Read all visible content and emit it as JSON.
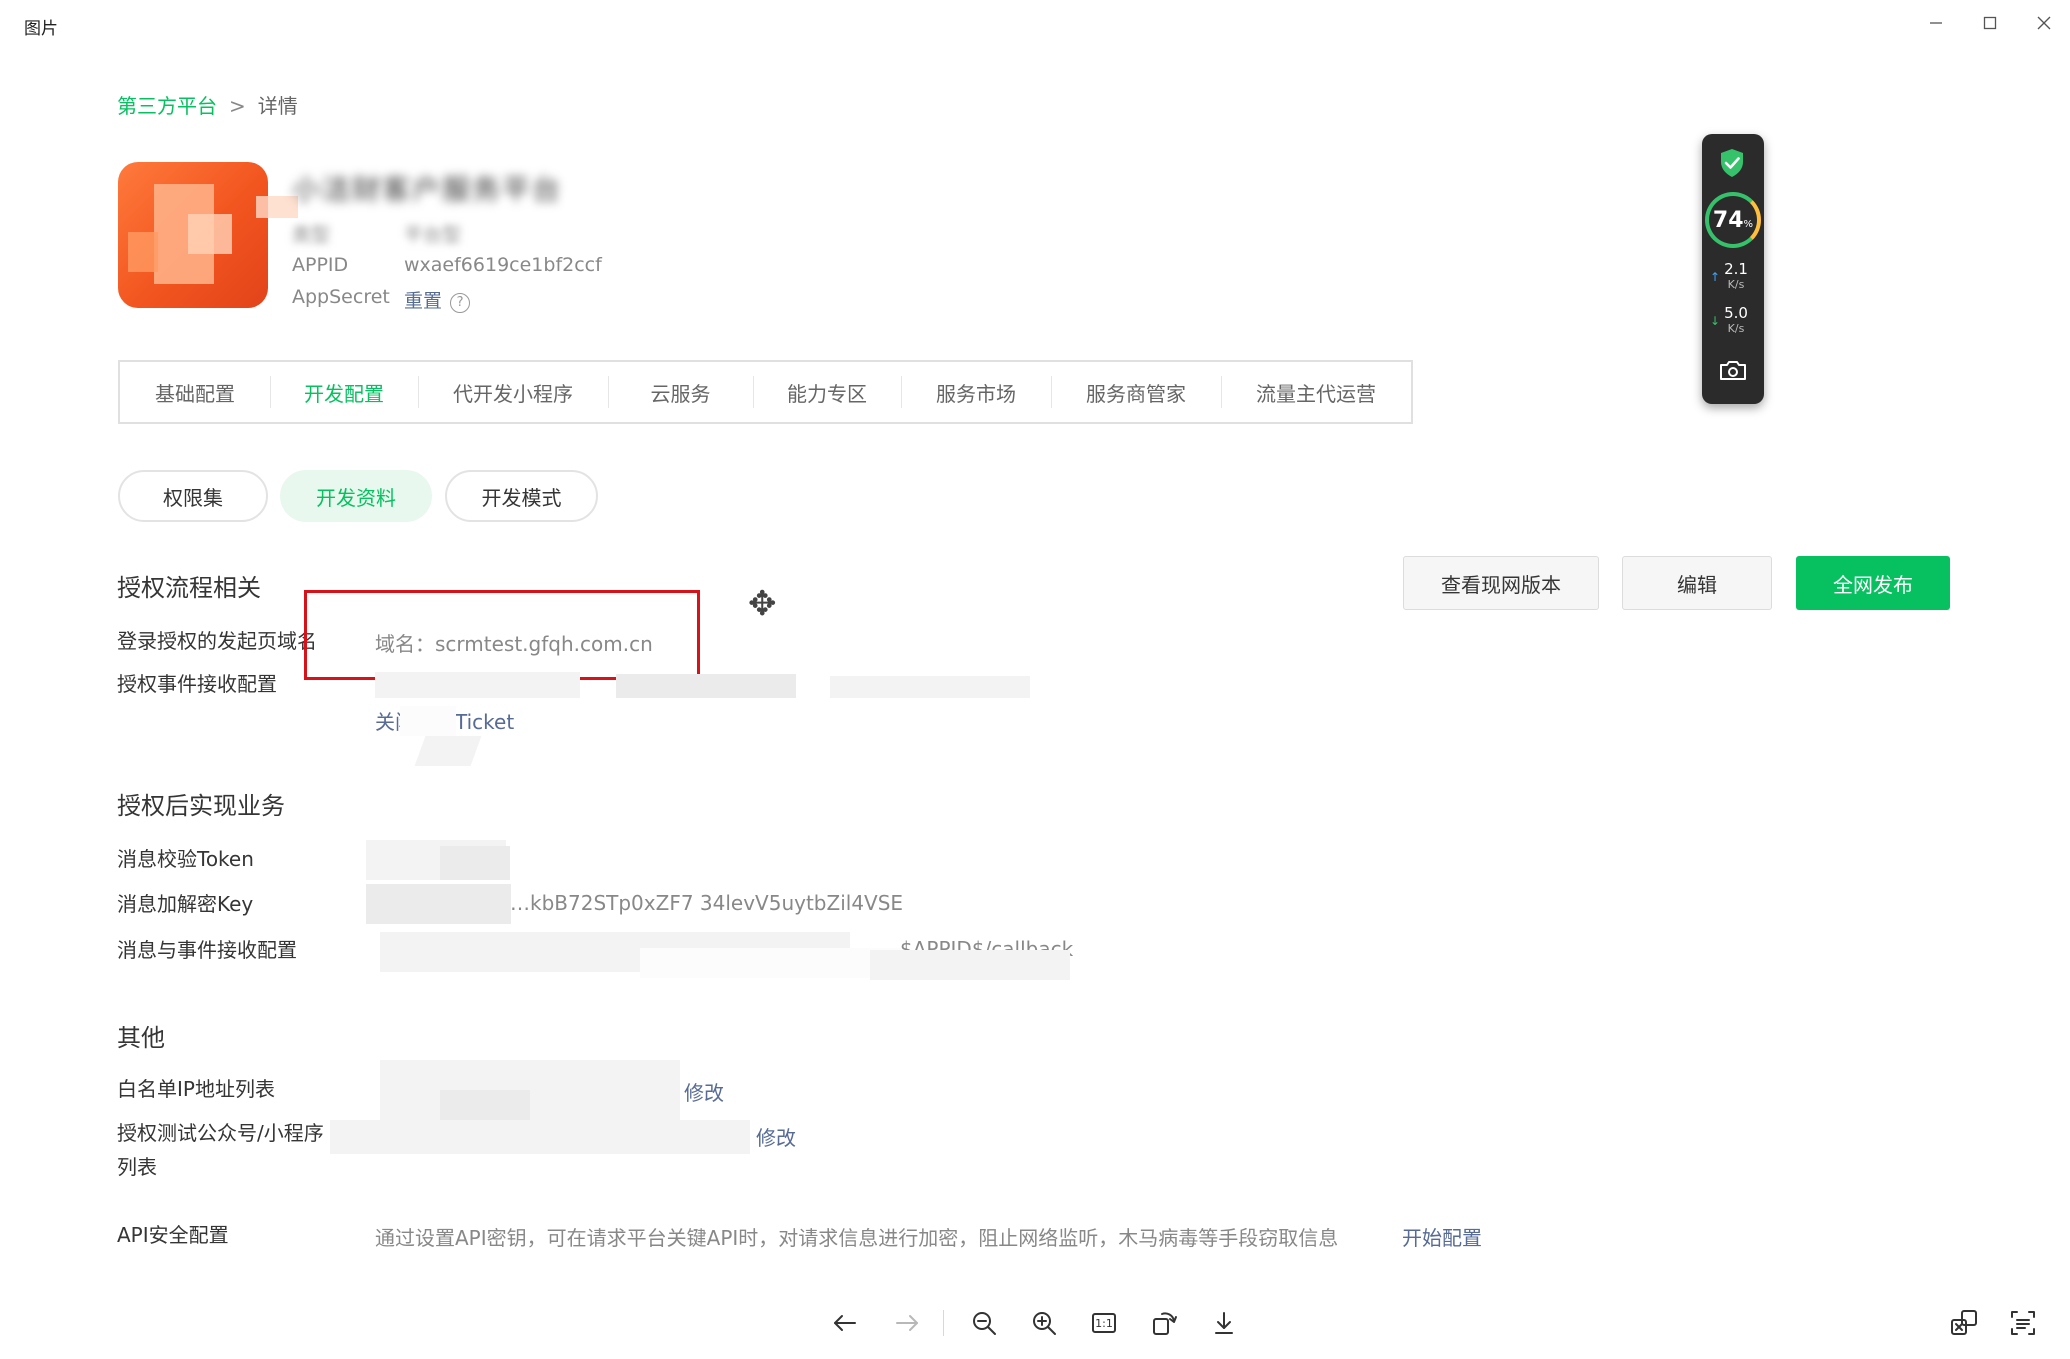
{
  "window": {
    "title": "图片",
    "minimize_icon": "minimize-icon",
    "maximize_icon": "maximize-icon",
    "close_icon": "close-icon"
  },
  "breadcrumb": {
    "root": "第三方平台",
    "separator": ">",
    "current": "详情"
  },
  "app_info": {
    "name": "小洁财客户服务平台",
    "type_label": "类型",
    "type_value": "平台型",
    "appid_label": "APPID",
    "appid_value": "wxaef6619ce1bf2ccf",
    "appsecret_label": "AppSecret",
    "reset_link": "重置",
    "help_icon": "question-circle-icon"
  },
  "tabs": [
    {
      "label": "基础配置",
      "active": false
    },
    {
      "label": "开发配置",
      "active": true
    },
    {
      "label": "代开发小程序",
      "active": false
    },
    {
      "label": "云服务",
      "active": false
    },
    {
      "label": "能力专区",
      "active": false
    },
    {
      "label": "服务市场",
      "active": false
    },
    {
      "label": "服务商管家",
      "active": false
    },
    {
      "label": "流量主代运营",
      "active": false
    }
  ],
  "subtabs": [
    {
      "label": "权限集",
      "active": false
    },
    {
      "label": "开发资料",
      "active": true
    },
    {
      "label": "开发模式",
      "active": false
    }
  ],
  "actions": {
    "view_live": "查看现网版本",
    "edit": "编辑",
    "publish": "全网发布"
  },
  "section_auth_flow": {
    "title": "授权流程相关",
    "login_domain_label": "登录授权的发起页域名",
    "login_domain_value": "域名：scrmtest.gfqh.com.cn",
    "event_receive_label": "授权事件接收配置",
    "event_receive_link": "关闭推送Ticket"
  },
  "section_business": {
    "title": "授权后实现业务",
    "token_label": "消息校验Token",
    "key_label": "消息加解密Key",
    "key_value": "…kbB72STp0xZF7  34levV5uytbZil4VSE",
    "callback_label": "消息与事件接收配置",
    "callback_value": "…$APPID$/callback"
  },
  "section_other": {
    "title": "其他",
    "ip_label": "白名单IP地址列表",
    "ip_edit": "修改",
    "test_account_label": "授权测试公众号/小程序列表",
    "test_account_edit": "修改",
    "api_label": "API安全配置",
    "api_desc": "通过设置API密钥，可在请求平台关键API时，对请求信息进行加密，阻止网络监听，木马病毒等手段窃取信息",
    "api_link": "开始配置"
  },
  "speed_widget": {
    "shield_icon": "shield-check-icon",
    "load_percent": 74,
    "load_unit": "%",
    "upload_speed": "2.1",
    "upload_unit": "K/s",
    "download_speed": "5.0",
    "download_unit": "K/s",
    "camera_icon": "camera-icon",
    "accent_green": "#35c26b",
    "accent_orange": "#ffbf3c"
  },
  "viewer_toolbar": {
    "icons": [
      "arrow-left-icon",
      "arrow-right-icon",
      "zoom-out-icon",
      "zoom-in-icon",
      "actual-size-icon",
      "rotate-icon",
      "download-icon",
      "ocr-translate-icon",
      "text-extract-icon"
    ],
    "actual_size_label": "1:1"
  },
  "colors": {
    "brand_green": "#07c160",
    "link_blue": "#576b95",
    "highlight_red": "#d9121a"
  }
}
